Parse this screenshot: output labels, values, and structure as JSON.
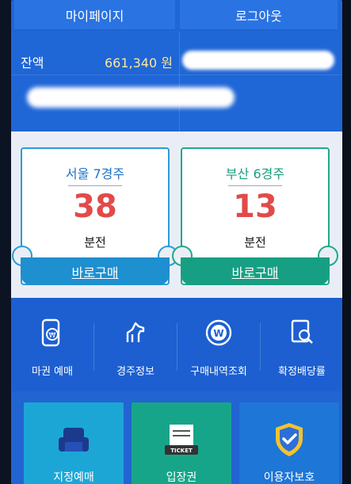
{
  "header": {
    "mypage_label": "마이페이지",
    "logout_label": "로그아웃"
  },
  "account": {
    "balance_label": "잔액",
    "balance_value": "661,340 원"
  },
  "race_cards": [
    {
      "venue": "서울 7경주",
      "minutes": "38",
      "unit": "분전",
      "cta": "바로구매"
    },
    {
      "venue": "부산 6경주",
      "minutes": "13",
      "unit": "분전",
      "cta": "바로구매"
    }
  ],
  "menu": [
    {
      "label": "마권 예매",
      "icon": "mobile-ticket-icon"
    },
    {
      "label": "경주정보",
      "icon": "horse-icon"
    },
    {
      "label": "구매내역조회",
      "icon": "won-coin-icon"
    },
    {
      "label": "확정배당률",
      "icon": "document-search-icon"
    }
  ],
  "tiles": [
    {
      "label": "지정예매",
      "icon": "armchair-icon",
      "color": "#1ca6d6"
    },
    {
      "label": "입장권",
      "icon": "ticket-icon",
      "color": "#17a58a"
    },
    {
      "label": "이용자보호",
      "icon": "shield-check-icon",
      "color": "#1e76d6"
    }
  ],
  "colors": {
    "background": "#1f66d6",
    "seoul_accent": "#1e8fcf",
    "busan_accent": "#179f83",
    "minutes": "#e24a4a",
    "balance": "#ffe69a"
  }
}
